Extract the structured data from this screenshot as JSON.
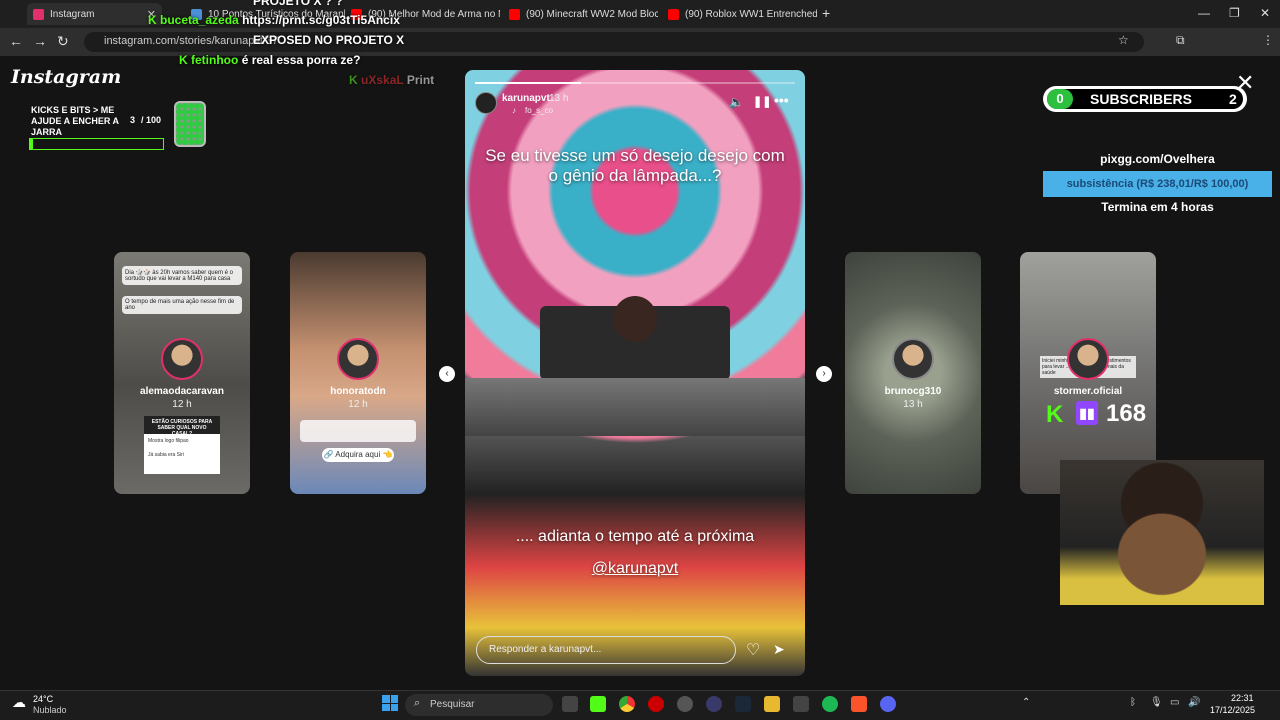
{
  "browser": {
    "tabs": [
      {
        "label": "Instagram",
        "color": "#e1306c"
      },
      {
        "label": "10 Pontos Turísticos do Maranh",
        "color": "#4a90d9"
      },
      {
        "label": "(90) Melhor Mod de Arma no M",
        "color": "#ff0000"
      },
      {
        "label": "(90) Minecraft WW2 Mod Block",
        "color": "#ff0000"
      },
      {
        "label": "(90) Roblox WW1 Entrenched (",
        "color": "#ff0000"
      }
    ],
    "new_tab": "+",
    "url": "instagram.com/stories/karunapvt/37",
    "window_controls": [
      "—",
      "❐",
      "✕"
    ]
  },
  "overlay_chat": [
    {
      "user": "",
      "text": "PROJETO X ? ?"
    },
    {
      "user": "buceta_azeda",
      "text": "https://prnt.sc/g03tTi5Ancix"
    },
    {
      "user": "",
      "text": "EXPOSED NO PROJETO X"
    },
    {
      "user": "fetinhoo",
      "text": "é real essa porra ze?"
    },
    {
      "user": "uXskaL",
      "text": "Print"
    }
  ],
  "kicks_widget": {
    "label": "KICKS E BITS > ME AJUDE A ENCHER A JARRA",
    "count": "3",
    "total": "/ 100"
  },
  "instagram": {
    "logo": "Instagram",
    "close": "✕",
    "main_story": {
      "user": "karunapvt",
      "time": "13 h",
      "audio": "fo_s_co",
      "text_top": "Se eu tivesse um só desejo desejo com o gênio da lâmpada...?",
      "text_bottom": ".... adianta o tempo até a próxima",
      "mention": "@karunapvt",
      "reply_placeholder": "Responder a karunapvt..."
    },
    "stories": [
      {
        "user": "alemaodacaravan",
        "time": "12 h",
        "bg": "#6b6a66",
        "caption": "Dia 🎲🎲 às 20h vamos saber quem é o sortudo que vai levar a M140 para casa",
        "sub": "O tempo de mais uma ação nesse fim de ano",
        "question": "ESTÃO CURIOSOS PARA SABER QUAL NOVO CASAL?",
        "answer1": "Mostra logo filipao",
        "answer2": "Já sabia era Siri"
      },
      {
        "user": "honoratodn",
        "time": "12 h",
        "bg": "#b88c70",
        "link": "🔗 Adquira aqui 👈"
      },
      {
        "user": "brunocg310",
        "time": "13 h",
        "bg": "#5d6358"
      },
      {
        "user": "stormer.oficial",
        "time": "",
        "bg": "#7a7a78",
        "caption": "Iniciei minha promoção ... investimentos para levar ... para os profissionais da saúde"
      }
    ]
  },
  "subscribers": {
    "current": "0",
    "label": "SUBSCRIBERS",
    "goal": "2"
  },
  "donation": {
    "site": "pixgg.com/Ovelhera",
    "goal_text": "subsistência (R$ 238,01/R$ 100,00)",
    "ends": "Termina em 4 horas"
  },
  "viewers": {
    "count": "168"
  },
  "taskbar": {
    "weather_temp": "24°C",
    "weather_text": "Nublado",
    "search": "Pesquisar",
    "time": "22:31",
    "date": "17/12/2025"
  }
}
